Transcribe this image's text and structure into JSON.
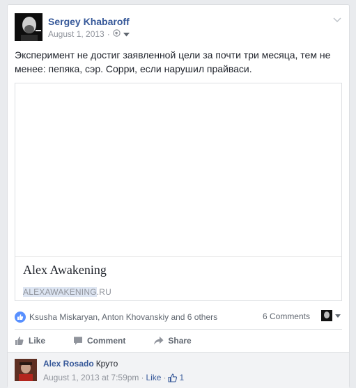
{
  "post": {
    "author": "Sergey Khabaroff",
    "date": "August 1, 2013",
    "separator": "·",
    "text": "Эксперимент не достиг заявленной цели за почти три месяца, тем не менее: пепяка, сэр. Сорри, если нарушил прайваси."
  },
  "link": {
    "title": "Alex Awakening",
    "domain_highlight": "ALEXAWAKENING",
    "domain_rest": ".RU"
  },
  "reactions": {
    "names": "Ksusha Miskaryan, Anton Khovanskiy and 6 others",
    "comments": "6 Comments"
  },
  "actions": {
    "like": "Like",
    "comment": "Comment",
    "share": "Share"
  },
  "comment": {
    "author": "Alex Rosado",
    "text": "Круто",
    "timestamp": "August 1, 2013 at 7:59pm",
    "separator": "·",
    "like": "Like",
    "separator2": "·",
    "likes_count": "1"
  },
  "colors": {
    "link_blue": "#365899",
    "like_blue": "#5890ff",
    "meta_gray": "#90949c"
  }
}
